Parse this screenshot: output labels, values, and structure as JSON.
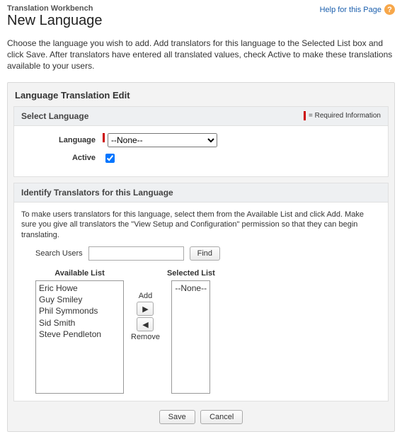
{
  "breadcrumb": "Translation Workbench",
  "help": {
    "label": "Help for this Page"
  },
  "page_title": "New Language",
  "intro": "Choose the language you wish to add. Add translators for this language to the Selected List box and click Save. After translators have entered all translated values, check Active to make these translations available to your users.",
  "panel_title": "Language Translation Edit",
  "select_lang": {
    "header": "Select Language",
    "required_info": "= Required Information",
    "language_label": "Language",
    "language_value": "--None--",
    "active_label": "Active"
  },
  "translators": {
    "header": "Identify Translators for this Language",
    "desc": "To make users translators for this language, select them from the Available List and click Add. Make sure you give all translators the \"View Setup and Configuration\" permission so that they can begin translating.",
    "search_label": "Search Users",
    "find_label": "Find",
    "available_title": "Available List",
    "selected_title": "Selected List",
    "add_label": "Add",
    "remove_label": "Remove",
    "available": [
      "Eric Howe",
      "Guy Smiley",
      "Phil Symmonds",
      "Sid Smith",
      "Steve Pendleton"
    ],
    "selected": [
      "--None--"
    ]
  },
  "buttons": {
    "save": "Save",
    "cancel": "Cancel"
  }
}
